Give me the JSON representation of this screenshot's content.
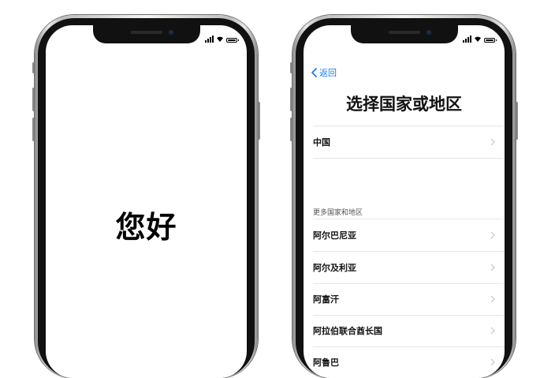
{
  "left_phone": {
    "greeting": "您好"
  },
  "right_phone": {
    "back_label": "返回",
    "title": "选择国家或地区",
    "primary_country": "中国",
    "more_section_header": "更多国家和地区",
    "countries": [
      "阿尔巴尼亚",
      "阿尔及利亚",
      "阿富汗",
      "阿拉伯联合酋长国",
      "阿鲁巴"
    ]
  },
  "status_bar": {
    "icons": [
      "signal-icon",
      "wifi-icon",
      "battery-icon"
    ],
    "battery_level": 1.0
  },
  "colors": {
    "accent": "#1a7cf2",
    "background": "#ffffff",
    "chevron": "#c4c4c4"
  }
}
